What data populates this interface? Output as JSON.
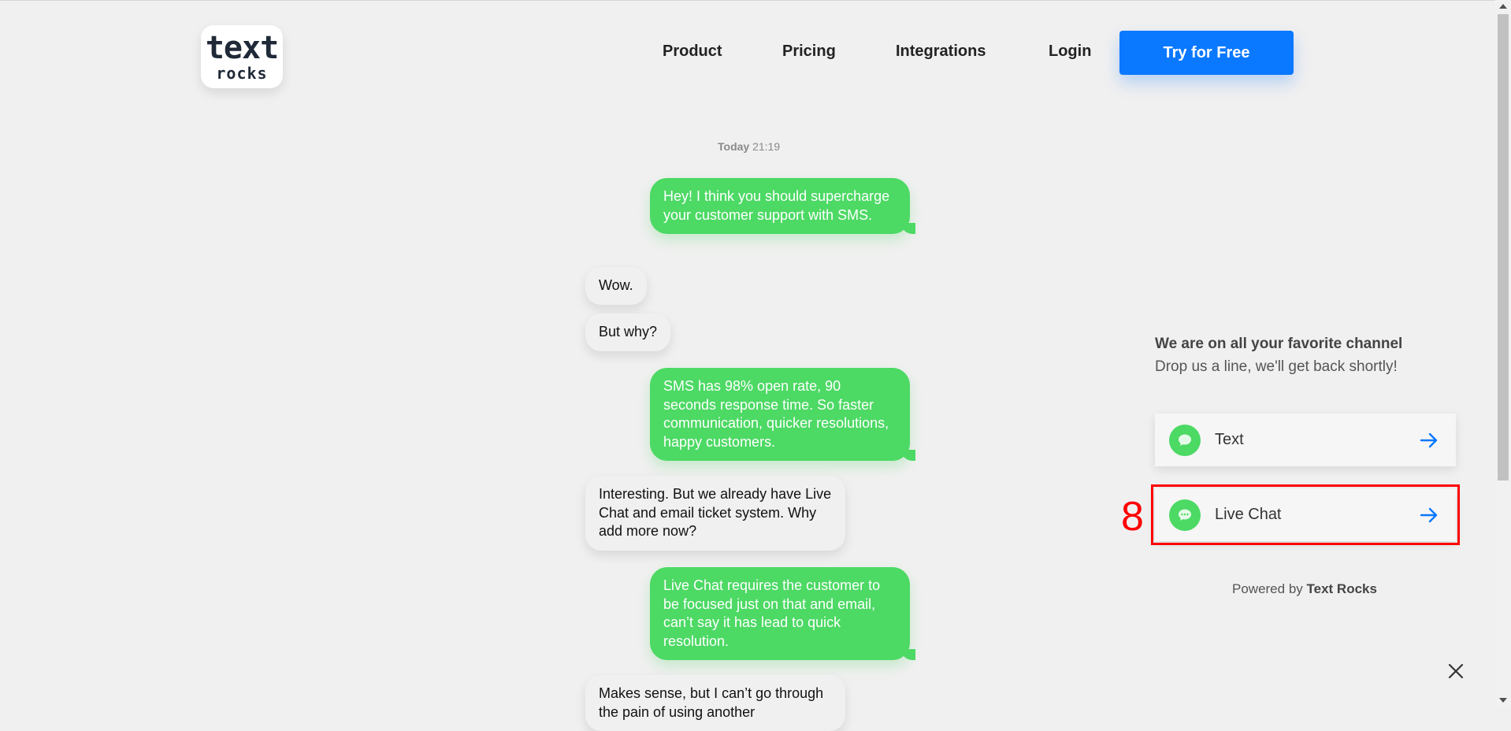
{
  "header": {
    "logo": {
      "line1": "text",
      "line2": "rocks"
    },
    "nav": [
      "Product",
      "Pricing",
      "Integrations",
      "Login"
    ],
    "cta": "Try for Free"
  },
  "chat": {
    "timestamp_day": "Today",
    "timestamp_time": "21:19",
    "messages": [
      {
        "from": "out",
        "text": "Hey! I think you should supercharge your customer support with SMS."
      },
      {
        "from": "in",
        "text": "Wow."
      },
      {
        "from": "in",
        "text": "But why?"
      },
      {
        "from": "out",
        "text": "SMS has 98% open rate, 90 seconds response time. So faster communication, quicker resolutions, happy customers."
      },
      {
        "from": "in",
        "text": "Interesting. But we already have Live Chat and email ticket system. Why add more now?"
      },
      {
        "from": "out",
        "text": "Live Chat requires the customer to be focused just on that and email, can’t say it has lead to quick resolution."
      },
      {
        "from": "in",
        "text": "Makes sense, but I can’t go through the pain of using another"
      }
    ]
  },
  "widget": {
    "title": "We are on all your favorite channel",
    "subtitle": "Drop us a line, we'll get back shortly!",
    "channels": [
      {
        "label": "Text",
        "icon": "chat-bubble-icon"
      },
      {
        "label": "Live Chat",
        "icon": "chat-dots-icon"
      }
    ],
    "marker": "8",
    "powered_prefix": "Powered by",
    "powered_brand": "Text Rocks"
  },
  "colors": {
    "accent_blue": "#0a78ff",
    "bubble_green": "#4cd964",
    "highlight_red": "#ff0000",
    "background": "#f0f0f0"
  }
}
